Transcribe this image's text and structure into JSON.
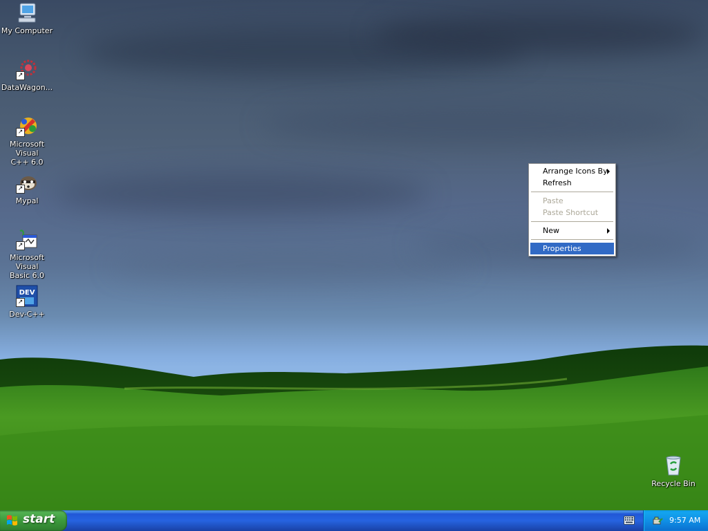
{
  "desktop_icons": [
    {
      "label": "My Computer",
      "icon": "my-computer-icon"
    },
    {
      "label": "DataWagon...",
      "icon": "datawagon-icon"
    },
    {
      "label": "Microsoft Visual\nC++ 6.0",
      "icon": "visual-cpp-icon"
    },
    {
      "label": "Mypal",
      "icon": "mypal-icon"
    },
    {
      "label": "Microsoft Visual\nBasic 6.0",
      "icon": "visual-basic-icon"
    },
    {
      "label": "Dev-C++",
      "icon": "dev-cpp-icon"
    },
    {
      "label": "Recycle Bin",
      "icon": "recycle-bin-icon"
    }
  ],
  "context_menu": {
    "items": [
      {
        "label": "Arrange Icons By",
        "submenu": true,
        "enabled": true
      },
      {
        "label": "Refresh",
        "submenu": false,
        "enabled": true
      },
      {
        "label": "Paste",
        "submenu": false,
        "enabled": false
      },
      {
        "label": "Paste Shortcut",
        "submenu": false,
        "enabled": false
      },
      {
        "label": "New",
        "submenu": true,
        "enabled": true
      },
      {
        "label": "Properties",
        "submenu": false,
        "enabled": true,
        "highlighted": true
      }
    ]
  },
  "taskbar": {
    "start_label": "start",
    "clock": "9:57 AM"
  },
  "colors": {
    "menu_highlight": "#316ac5",
    "taskbar_blue": "#2663e0",
    "start_green": "#3c9a3c",
    "tray_blue": "#1090e6"
  }
}
